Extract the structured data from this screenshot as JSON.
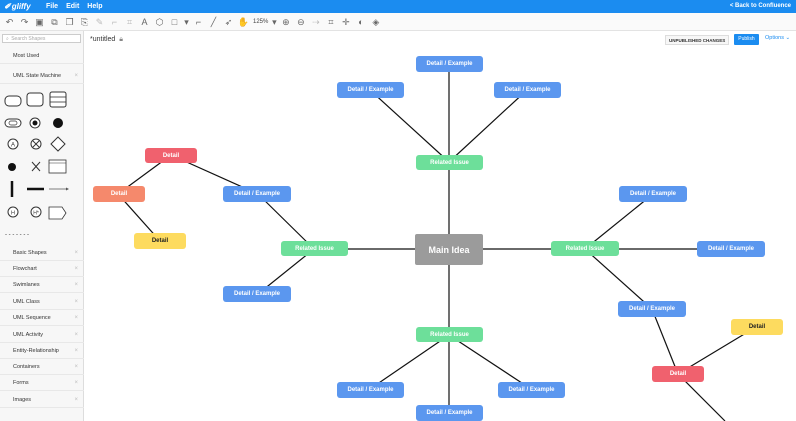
{
  "topbar": {
    "logo": "gliffy",
    "menu": [
      "File",
      "Edit",
      "Help"
    ],
    "back_link": "< Back to Confluence"
  },
  "toolbar": {
    "zoom": "125%"
  },
  "sidebar": {
    "search_placeholder": "Search Shapes",
    "most_used": "Most Used",
    "uml_state_machine": "UML State Machine",
    "divider": "- - - - - - -",
    "libraries": [
      "Basic Shapes",
      "Flowchart",
      "Swimlanes",
      "UML Class",
      "UML Sequence",
      "UML Activity",
      "Entity-Relationship",
      "Containers",
      "Forms",
      "Images"
    ]
  },
  "document": {
    "title": "*untitled",
    "unpublished": "UNPUBLISHED CHANGES",
    "publish": "Publish",
    "options": "Options"
  },
  "colors": {
    "blue": "#5b97ef",
    "green": "#6ddf9a",
    "red": "#f0616e",
    "salmon": "#f5896c",
    "yellow": "#fddb5f",
    "gray": "#9b9b9b"
  },
  "diagram": {
    "main": "Main Idea",
    "related": "Related Issue",
    "detail_example": "Detail / Example",
    "detail": "Detail"
  }
}
